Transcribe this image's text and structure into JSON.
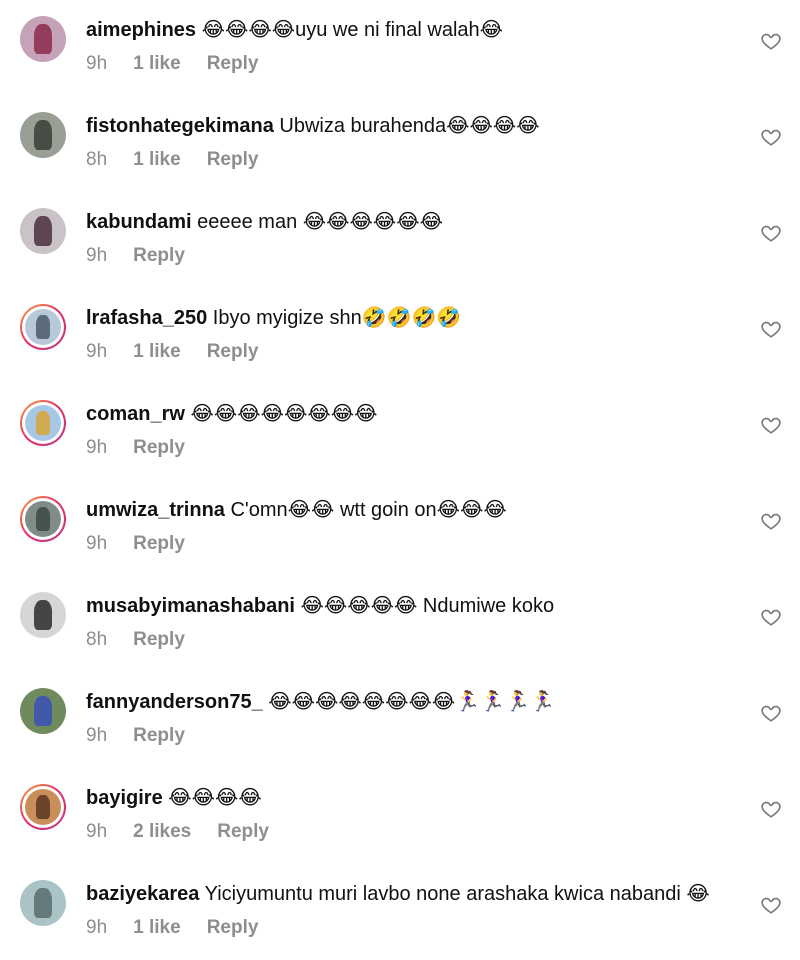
{
  "comments": [
    {
      "username": "aimephines",
      "text": " 😂😂😂😂uyu we ni final walah😂",
      "time": "9h",
      "likes": "1 like",
      "reply": "Reply",
      "avatar_bg": "#c6a2b8",
      "avatar_fg": "#8b2a4a",
      "ring": false
    },
    {
      "username": "fistonhategekimana",
      "text": " Ubwiza burahenda😂😂😂😂",
      "time": "8h",
      "likes": "1 like",
      "reply": "Reply",
      "avatar_bg": "#9a9f96",
      "avatar_fg": "#3a3d37",
      "ring": false
    },
    {
      "username": "kabundami",
      "text": " eeeee man 😂😂😂😂😂😂",
      "time": "9h",
      "likes": "",
      "reply": "Reply",
      "avatar_bg": "#c9c2c7",
      "avatar_fg": "#4a2f3c",
      "ring": false
    },
    {
      "username": "lrafasha_250",
      "text": " Ibyo myigize shn🤣🤣🤣🤣",
      "time": "9h",
      "likes": "1 like",
      "reply": "Reply",
      "avatar_bg": "#b7c9d8",
      "avatar_fg": "#4b5b6c",
      "ring": true
    },
    {
      "username": "coman_rw",
      "text": " 😂😂😂😂😂😂😂😂",
      "time": "9h",
      "likes": "",
      "reply": "Reply",
      "avatar_bg": "#a7c7e6",
      "avatar_fg": "#d8a636",
      "ring": true
    },
    {
      "username": "umwiza_trinna",
      "text": " C'omn😂😂 wtt goin on😂😂😂",
      "time": "9h",
      "likes": "",
      "reply": "Reply",
      "avatar_bg": "#7f8d86",
      "avatar_fg": "#3c4842",
      "ring": true
    },
    {
      "username": "musabyimanashabani",
      "text": " 😂😂😂😂😂 Ndumiwe koko",
      "time": "8h",
      "likes": "",
      "reply": "Reply",
      "avatar_bg": "#d6d6d6",
      "avatar_fg": "#2b2b2b",
      "ring": false
    },
    {
      "username": "fannyanderson75_",
      "text": " 😂😂😂😂😂😂😂😂🏃‍♀️🏃‍♀️🏃‍♀️🏃‍♀️",
      "time": "9h",
      "likes": "",
      "reply": "Reply",
      "avatar_bg": "#6f8a5c",
      "avatar_fg": "#3a4fb8",
      "ring": false
    },
    {
      "username": "bayigire",
      "text": " 😂😂😂😂",
      "time": "9h",
      "likes": "2 likes",
      "reply": "Reply",
      "avatar_bg": "#c98f5a",
      "avatar_fg": "#5a3620",
      "ring": true
    },
    {
      "username": "baziyekarea",
      "text": " Yiciyumuntu muri lavbo none arashaka kwica nabandi 😂",
      "time": "9h",
      "likes": "1 like",
      "reply": "Reply",
      "avatar_bg": "#a9c3c7",
      "avatar_fg": "#5a6d6f",
      "ring": false
    }
  ]
}
